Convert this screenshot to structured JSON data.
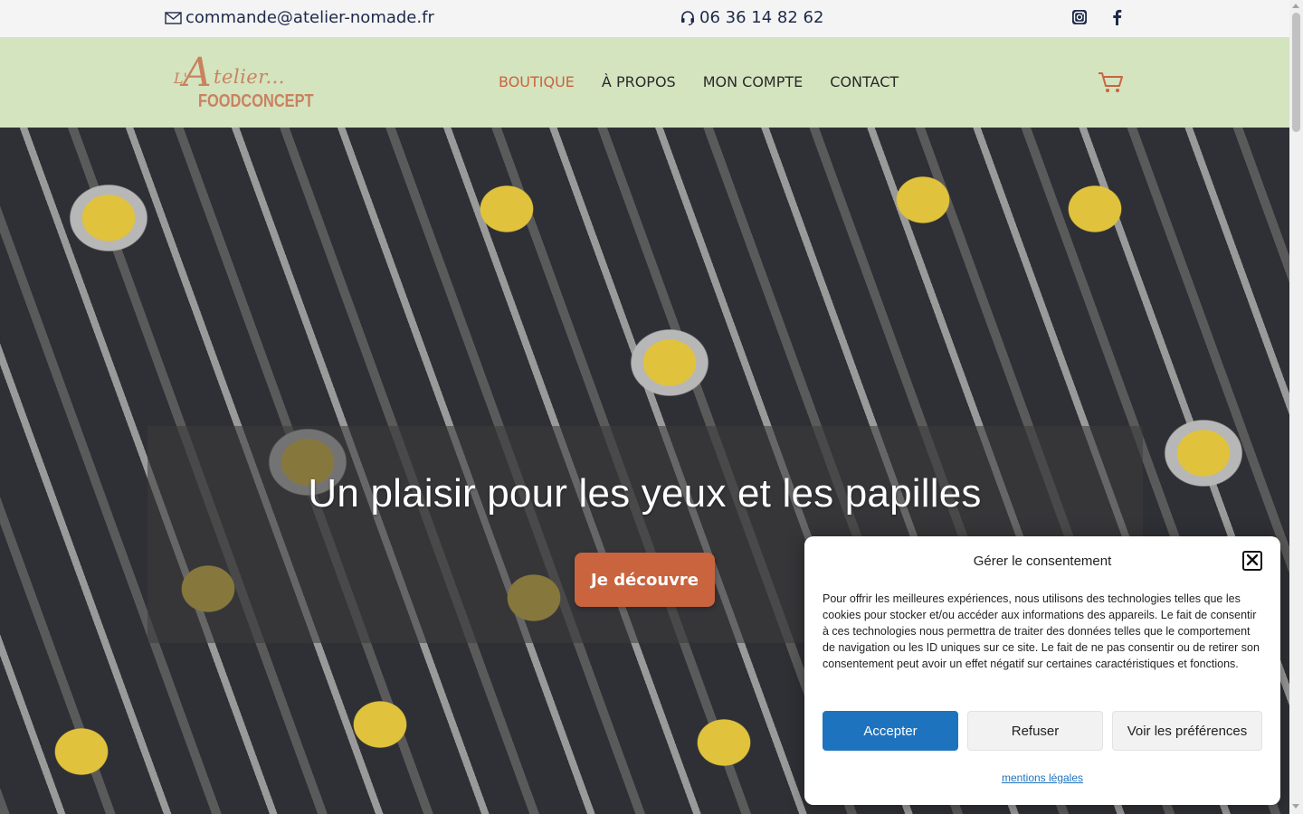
{
  "topbar": {
    "email": "commande@atelier-nomade.fr",
    "email_icon": "envelope-icon",
    "phone": "06 36 14 82 62",
    "phone_icon": "headset-icon",
    "social": [
      "instagram-icon",
      "facebook-icon"
    ]
  },
  "header": {
    "logo": {
      "script_prefix": "L'",
      "script_initial": "A",
      "script_rest": "telier...",
      "brand": "FOODCONCEPT"
    },
    "nav": [
      {
        "label": "BOUTIQUE",
        "active": true
      },
      {
        "label": "À PROPOS",
        "active": false
      },
      {
        "label": "MON COMPTE",
        "active": false
      },
      {
        "label": "CONTACT",
        "active": false
      }
    ],
    "cart_icon": "cart-icon"
  },
  "hero": {
    "title": "Un plaisir pour les yeux et les papilles",
    "cta": "Je découvre"
  },
  "consent": {
    "title": "Gérer le consentement",
    "body": "Pour offrir les meilleures expériences, nous utilisons des technologies telles que les cookies pour stocker et/ou accéder aux informations des appareils. Le fait de consentir à ces technologies nous permettra de traiter des données telles que le comportement de navigation ou les ID uniques sur ce site. Le fait de ne pas consentir ou de retirer son consentement peut avoir un effet négatif sur certaines caractéristiques et fonctions.",
    "accept": "Accepter",
    "refuse": "Refuser",
    "preferences": "Voir les préférences",
    "legal": "mentions légales"
  },
  "colors": {
    "accent": "#c9643f",
    "header_bg": "#d4e4bf",
    "primary_button": "#1e73be",
    "topbar_text": "#1e2a4a"
  }
}
